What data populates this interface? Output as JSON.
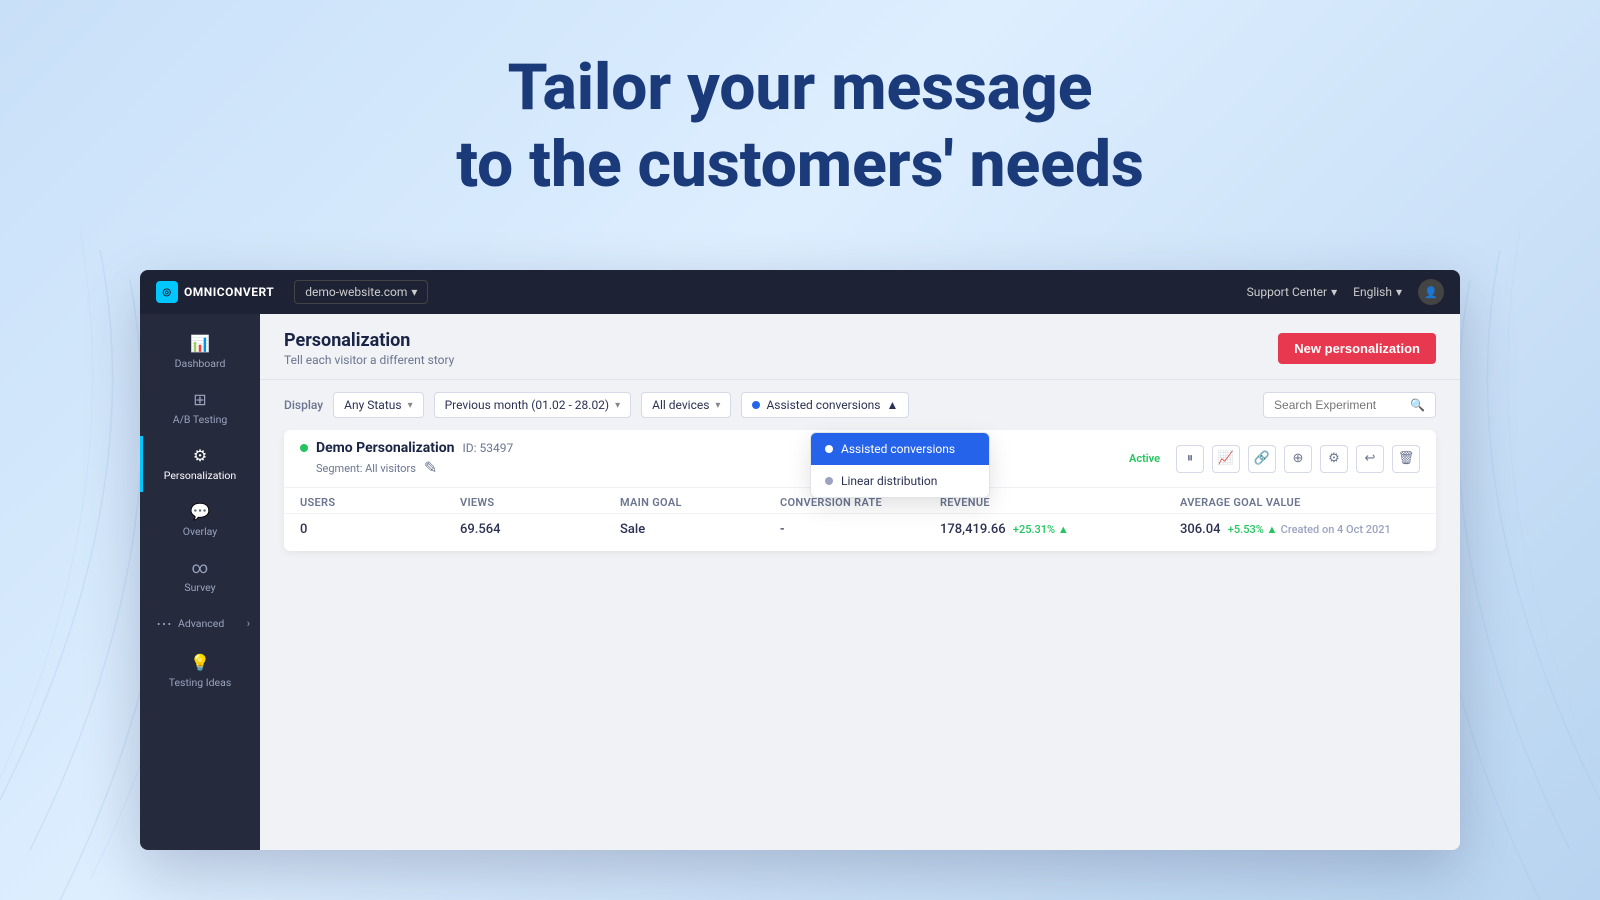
{
  "hero": {
    "line1": "Tailor your message",
    "line2": "to the customers' needs"
  },
  "navbar": {
    "brand": "OMNICONVERT",
    "site": "demo-website.com",
    "support": "Support Center",
    "language": "English",
    "chevron": "▾"
  },
  "sidebar": {
    "items": [
      {
        "id": "dashboard",
        "label": "Dashboard",
        "icon": "📊"
      },
      {
        "id": "ab-testing",
        "label": "A/B Testing",
        "icon": "⊞"
      },
      {
        "id": "personalization",
        "label": "Personalization",
        "icon": "⚙"
      },
      {
        "id": "overlay",
        "label": "Overlay",
        "icon": "💬"
      },
      {
        "id": "survey",
        "label": "Survey",
        "icon": "∞"
      },
      {
        "id": "advanced",
        "label": "Advanced",
        "icon": "⋯",
        "hasArrow": true
      },
      {
        "id": "testing-ideas",
        "label": "Testing Ideas",
        "icon": "💡"
      }
    ]
  },
  "page": {
    "title": "Personalization",
    "subtitle": "Tell each visitor a different story",
    "new_button": "New personalization"
  },
  "filters": {
    "display_label": "Display",
    "status_filter": "Any Status",
    "date_filter": "Previous month (01.02 - 28.02)",
    "device_filter": "All devices",
    "conversion_filter": "Assisted conversions",
    "search_placeholder": "Search Experiment"
  },
  "dropdown": {
    "items": [
      {
        "id": "assisted",
        "label": "Assisted conversions",
        "selected": true
      },
      {
        "id": "linear",
        "label": "Linear distribution",
        "selected": false
      }
    ]
  },
  "experiment": {
    "name": "Demo Personalization",
    "id": "ID: 53497",
    "segment": "Segment: All visitors",
    "status": "Active",
    "created": "Created on 4 Oct 2021",
    "stats": {
      "users": {
        "label": "Users",
        "value": "0"
      },
      "views": {
        "label": "Views",
        "value": "69.564"
      },
      "main_goal": {
        "label": "Main Goal",
        "value": "Sale"
      },
      "conversion_rate": {
        "label": "Conversion Rate",
        "value": "-"
      },
      "revenue": {
        "label": "Revenue",
        "value": "178,419.66",
        "change": "+25.31% ▲"
      },
      "avg_goal_value": {
        "label": "Average Goal Value",
        "value": "306.04",
        "change": "+5.53% ▲"
      }
    },
    "actions": [
      "⏸",
      "📊",
      "🔗",
      "🗑",
      "⊕",
      "↩",
      "🗑"
    ]
  }
}
